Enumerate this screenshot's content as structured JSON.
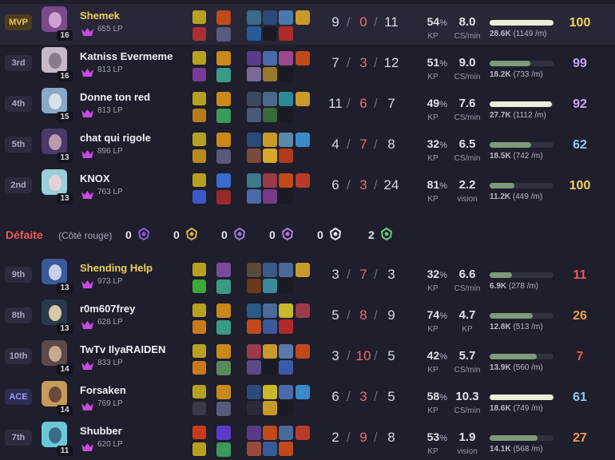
{
  "blue_team": [
    {
      "badge": "MVP",
      "badge_type": "mvp",
      "name": "Shemek",
      "name_gold": true,
      "level": "16",
      "lp": "655 LP",
      "kills": "9",
      "deaths": "0",
      "assists": "11",
      "kp": "54",
      "kp_unit": "%",
      "kp_label": "KP",
      "cs": "8.0",
      "cs_label": "CS/min",
      "damage_fraction": 1.0,
      "damage_total": "28.6K",
      "damage_rate": "(1149 /m)",
      "score": "100",
      "score_color": "#f2d35c",
      "champ_colors": [
        "#7a4a8a",
        "#d0a0d0"
      ],
      "spells": [
        "#b8a020",
        "#a83030",
        "#8a9a20",
        "#4a4a5a"
      ],
      "runes": [
        "#c04a1a",
        "#5a5a7a"
      ],
      "items": [
        "#3a6a8a",
        "#2a4a7a",
        "#4a7aaa",
        "#c89a2a",
        "#2a5a9a",
        "#1a1a24",
        "#b02a2a"
      ]
    },
    {
      "badge": "3rd",
      "badge_type": "",
      "name": "Katniss Evermeme",
      "name_gold": false,
      "level": "16",
      "lp": "813 LP",
      "kills": "7",
      "deaths": "3",
      "assists": "12",
      "kp": "51",
      "kp_unit": "%",
      "kp_label": "KP",
      "cs": "9.0",
      "cs_label": "CS/min",
      "damage_fraction": 0.64,
      "damage_total": "18.2K",
      "damage_rate": "(733 /m)",
      "score": "99",
      "score_color": "#c7a6f2",
      "champ_colors": [
        "#c8b8c8",
        "#8a7a8a"
      ],
      "spells": [
        "#b8a020",
        "#7a3a9a",
        "#c87a1a",
        "#3a8a9a"
      ],
      "runes": [
        "#c8881a",
        "#3a9a8a"
      ],
      "items": [
        "#5a3a8a",
        "#4a6aaa",
        "#9a4a8a",
        "#c04a1a",
        "#7a6a9a",
        "#9a7a2a",
        "#1a1a24"
      ]
    },
    {
      "badge": "4th",
      "badge_type": "",
      "name": "Donne ton red",
      "name_gold": false,
      "level": "15",
      "lp": "813 LP",
      "kills": "11",
      "deaths": "6",
      "assists": "7",
      "kp": "49",
      "kp_unit": "%",
      "kp_label": "KP",
      "cs": "7.6",
      "cs_label": "CS/min",
      "damage_fraction": 0.97,
      "damage_total": "27.7K",
      "damage_rate": "(1112 /m)",
      "score": "92",
      "score_color": "#c7a6f2",
      "champ_colors": [
        "#8aa8c8",
        "#d8e0ea"
      ],
      "spells": [
        "#b8a020",
        "#b87a1a",
        "#8a9a20",
        "#3a8a9a"
      ],
      "runes": [
        "#c8881a",
        "#3a9a5a"
      ],
      "items": [
        "#3a4a5a",
        "#4a6a8a",
        "#2a8a9a",
        "#c89a2a",
        "#4a5a7a",
        "#3a6a3a",
        "#1a1a24"
      ]
    },
    {
      "badge": "5th",
      "badge_type": "",
      "name": "chat qui rigole",
      "name_gold": false,
      "level": "13",
      "lp": "896 LP",
      "kills": "4",
      "deaths": "7",
      "assists": "8",
      "kp": "32",
      "kp_unit": "%",
      "kp_label": "KP",
      "cs": "6.5",
      "cs_label": "CS/min",
      "damage_fraction": 0.65,
      "damage_total": "18.5K",
      "damage_rate": "(742 /m)",
      "score": "62",
      "score_color": "#8ec9ee",
      "champ_colors": [
        "#4a3a6a",
        "#b89aaa"
      ],
      "spells": [
        "#b8a020",
        "#b88a1a",
        "#8a9a20",
        "#4a4a5a"
      ],
      "runes": [
        "#c8881a",
        "#5a5a7a"
      ],
      "items": [
        "#2a4a7a",
        "#c89a2a",
        "#5a8aaa",
        "#3a8aca",
        "#7a4a3a",
        "#d8a82a",
        "#b03a1a"
      ]
    },
    {
      "badge": "2nd",
      "badge_type": "",
      "name": "KNOX",
      "name_gold": false,
      "level": "13",
      "lp": "763 LP",
      "kills": "6",
      "deaths": "3",
      "assists": "24",
      "kp": "81",
      "kp_unit": "%",
      "kp_label": "KP",
      "cs": "2.2",
      "cs_label": "vision",
      "damage_fraction": 0.39,
      "damage_total": "11.2K",
      "damage_rate": "(449 /m)",
      "score": "100",
      "score_color": "#f2d35c",
      "champ_colors": [
        "#9ad0d8",
        "#e8d0d8"
      ],
      "spells": [
        "#b8a020",
        "#3a5ac8",
        "#3a9a3a",
        "#9a3a1a"
      ],
      "runes": [
        "#3a6aca",
        "#9a2a2a"
      ],
      "items": [
        "#3a7a8a",
        "#9a3a4a",
        "#c04a1a",
        "#b83a2a",
        "#4a6aaa",
        "#7a3a8a",
        "#1a1a24"
      ]
    }
  ],
  "red_header": {
    "result": "Défaite",
    "side": "(Côté rouge)",
    "objectives": [
      {
        "count": "0",
        "icon": "baron-icon",
        "color": "#8a5ad8"
      },
      {
        "count": "0",
        "icon": "dragon-icon",
        "color": "#d8b04a"
      },
      {
        "count": "0",
        "icon": "herald-icon",
        "color": "#9a7ad8"
      },
      {
        "count": "0",
        "icon": "grub-icon",
        "color": "#b07ae0"
      },
      {
        "count": "0",
        "icon": "tower-icon",
        "color": "#e6e6ee"
      },
      {
        "count": "2",
        "icon": "atakhan-icon",
        "color": "#6ac87a"
      }
    ]
  },
  "red_team": [
    {
      "badge": "9th",
      "badge_type": "",
      "name": "Shending Help",
      "name_gold": true,
      "level": "13",
      "lp": "973 LP",
      "kills": "3",
      "deaths": "7",
      "assists": "3",
      "kp": "32",
      "kp_unit": "%",
      "kp_label": "KP",
      "cs": "6.6",
      "cs_label": "CS/min",
      "damage_fraction": 0.35,
      "damage_total": "6.9K",
      "damage_rate": "(278 /m)",
      "score": "11",
      "score_color": "#ec5b5b",
      "champ_colors": [
        "#3a5a9a",
        "#c8d0e8"
      ],
      "spells": [
        "#b8a020",
        "#3aa83a",
        "#8a5a9a",
        "#3a8a9a"
      ],
      "runes": [
        "#7a4a9a",
        "#3a9a8a"
      ],
      "items": [
        "#5a4a3a",
        "#3a5a8a",
        "#4a6a9a",
        "#c89a2a",
        "#6a3a1a",
        "#3a8a9a",
        "#1a1a24"
      ]
    },
    {
      "badge": "8th",
      "badge_type": "",
      "name": "r0m607frey",
      "name_gold": false,
      "level": "13",
      "lp": "628 LP",
      "kills": "5",
      "deaths": "8",
      "assists": "9",
      "kp": "74",
      "kp_unit": "%",
      "kp_label": "KP",
      "cs": "4.7",
      "cs_label": "KP",
      "damage_fraction": 0.68,
      "damage_total": "12.8K",
      "damage_rate": "(513 /m)",
      "score": "26",
      "score_color": "#f29b4a",
      "champ_colors": [
        "#2a3a4a",
        "#d8c8a8"
      ],
      "spells": [
        "#b8a020",
        "#c87a1a",
        "#c87a1a",
        "#3a8a9a"
      ],
      "runes": [
        "#c8881a",
        "#3a9a8a"
      ],
      "items": [
        "#2a5a8a",
        "#4a6a9a",
        "#c8b82a",
        "#9a3a4a",
        "#c04a1a",
        "#3a5a9a",
        "#b02a2a"
      ]
    },
    {
      "badge": "10th",
      "badge_type": "",
      "name": "TwTv IlyaRAIDEN",
      "name_gold": false,
      "level": "14",
      "lp": "833 LP",
      "kills": "3",
      "deaths": "10",
      "assists": "5",
      "kp": "42",
      "kp_unit": "%",
      "kp_label": "KP",
      "cs": "5.7",
      "cs_label": "CS/min",
      "damage_fraction": 0.74,
      "damage_total": "13.9K",
      "damage_rate": "(560 /m)",
      "score": "7",
      "score_color": "#ec5b5b",
      "champ_colors": [
        "#5a4a4a",
        "#c8a890"
      ],
      "spells": [
        "#b8a020",
        "#c87a1a",
        "#7a3a9a",
        "#3a8a9a"
      ],
      "runes": [
        "#c8881a",
        "#5a8a5a"
      ],
      "items": [
        "#9a3a4a",
        "#c89a2a",
        "#5a7aaa",
        "#c04a1a",
        "#5a4a8a",
        "#1a1a24",
        "#3a5aaa"
      ]
    },
    {
      "badge": "ACE",
      "badge_type": "ace",
      "name": "Forsaken",
      "name_gold": false,
      "level": "14",
      "lp": "769 LP",
      "kills": "6",
      "deaths": "3",
      "assists": "5",
      "kp": "58",
      "kp_unit": "%",
      "kp_label": "KP",
      "cs": "10.3",
      "cs_label": "CS/min",
      "damage_fraction": 1.0,
      "damage_total": "18.6K",
      "damage_rate": "(749 /m)",
      "score": "61",
      "score_color": "#8ec9ee",
      "champ_colors": [
        "#c89a5a",
        "#6a4a3a"
      ],
      "spells": [
        "#b8a020",
        "#3a3a4a",
        "#8a9a20",
        "#c8881a"
      ],
      "runes": [
        "#c8881a",
        "#5a5a7a"
      ],
      "items": [
        "#2a4a7a",
        "#c8b82a",
        "#4a6aaa",
        "#3a8aca",
        "#2a2a3a",
        "#c89a2a",
        "#1a1a24"
      ]
    },
    {
      "badge": "7th",
      "badge_type": "",
      "name": "Shubber",
      "name_gold": false,
      "level": "11",
      "lp": "620 LP",
      "kills": "2",
      "deaths": "9",
      "assists": "8",
      "kp": "53",
      "kp_unit": "%",
      "kp_label": "KP",
      "cs": "1.9",
      "cs_label": "vision",
      "damage_fraction": 0.75,
      "damage_total": "14.1K",
      "damage_rate": "(568 /m)",
      "score": "27",
      "score_color": "#f29b4a",
      "champ_colors": [
        "#6ac8d8",
        "#3a6a8a"
      ],
      "spells": [
        "#c83a1a",
        "#b8a020",
        "#3a5ac8",
        "#3a9a5a"
      ],
      "runes": [
        "#5a3ac8",
        "#3a9a5a"
      ],
      "items": [
        "#5a3a8a",
        "#c04a1a",
        "#4a6a9a",
        "#b83a2a",
        "#9a4a3a",
        "#3a5a9a",
        "#c04a1a"
      ]
    }
  ]
}
